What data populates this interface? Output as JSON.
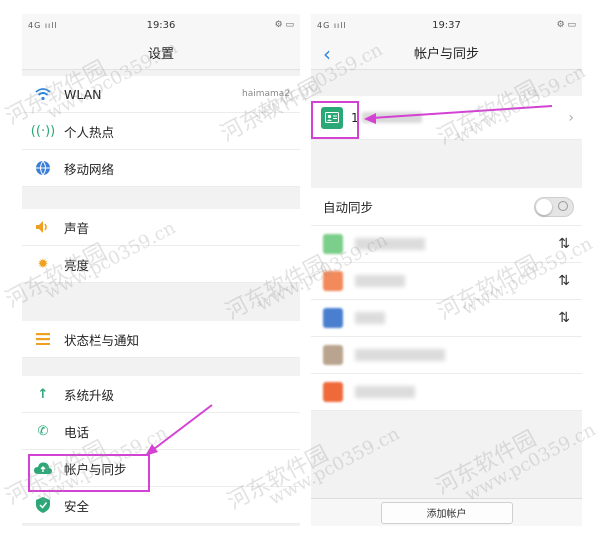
{
  "left": {
    "status": {
      "signal": "4G ııll",
      "time": "19:36"
    },
    "title": "设置",
    "groups": [
      [
        {
          "label": "WLAN",
          "value": "haimama2",
          "icon": "wifi-icon"
        },
        {
          "label": "个人热点",
          "icon": "hotspot-icon"
        },
        {
          "label": "移动网络",
          "icon": "globe-icon"
        }
      ],
      [
        {
          "label": "声音",
          "icon": "speaker-icon"
        },
        {
          "label": "亮度",
          "icon": "sun-icon"
        }
      ],
      [
        {
          "label": "状态栏与通知",
          "icon": "menu-icon"
        }
      ],
      [
        {
          "label": "系统升级",
          "icon": "arrow-up-icon"
        },
        {
          "label": "电话",
          "icon": "phone-icon"
        },
        {
          "label": "帐户与同步",
          "icon": "cloud-icon"
        },
        {
          "label": "安全",
          "icon": "shield-icon"
        }
      ]
    ]
  },
  "right": {
    "status": {
      "signal": "4G ııll",
      "time": "19:37"
    },
    "title": "帐户与同步",
    "account": {
      "number": "1",
      "icon": "contact-card-icon"
    },
    "auto_sync_label": "自动同步",
    "auto_sync_on": false,
    "services": [
      {
        "color": "#7ccf8a"
      },
      {
        "color": "#f28a5b"
      },
      {
        "color": "#4a7fd0"
      },
      {
        "color": "#b9a58f"
      },
      {
        "color": "#ef6a3b"
      }
    ],
    "add_account_label": "添加帐户"
  },
  "watermark": {
    "text1": "河东软件园",
    "text2": "www.pc0359.cn"
  },
  "colors": {
    "highlight": "#d442d4",
    "accent": "#2e86de",
    "account_green": "#2aa876"
  }
}
